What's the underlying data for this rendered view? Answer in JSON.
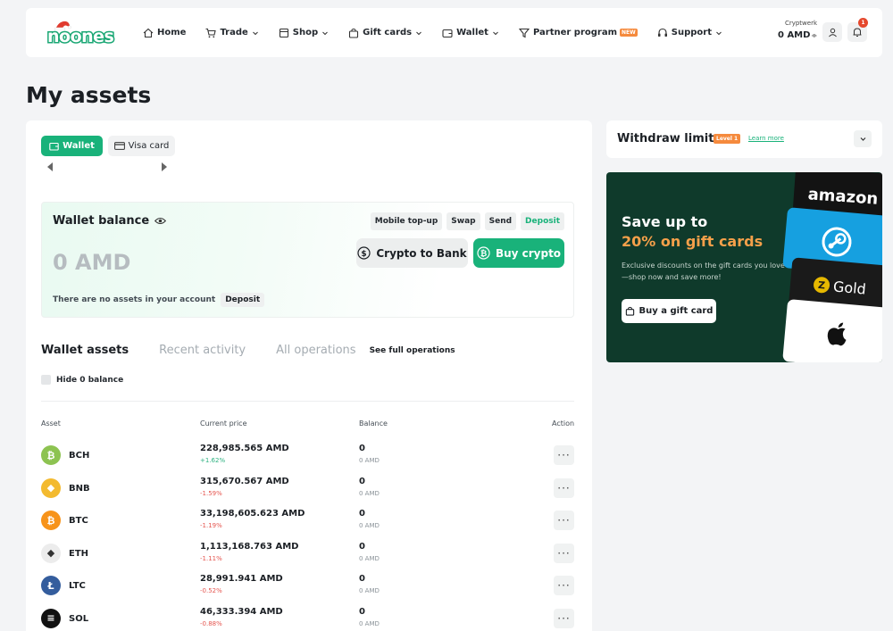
{
  "brand": {
    "logo_text": "noones",
    "accent": "#19b27a",
    "alert": "#e5482d"
  },
  "nav": {
    "items": [
      {
        "label": "Home",
        "icon": "home-icon",
        "dropdown": false
      },
      {
        "label": "Trade",
        "icon": "cart-icon",
        "dropdown": true
      },
      {
        "label": "Shop",
        "icon": "shop-icon",
        "dropdown": true
      },
      {
        "label": "Gift cards",
        "icon": "bag-icon",
        "dropdown": true
      },
      {
        "label": "Wallet",
        "icon": "wallet-icon",
        "dropdown": true
      },
      {
        "label": "Partner program",
        "icon": "partner-icon",
        "dropdown": false,
        "badge": "NEW"
      },
      {
        "label": "Support",
        "icon": "headset-icon",
        "dropdown": true
      }
    ],
    "account_name": "Cryptwerk",
    "account_balance": "0 AMD",
    "notifications": "1"
  },
  "page_title": "My assets",
  "wallet_tabs": {
    "wallet": "Wallet",
    "visa": "Visa card"
  },
  "balance": {
    "title": "Wallet balance",
    "quick_actions": [
      "Mobile top-up",
      "Swap",
      "Send",
      "Deposit"
    ],
    "amount": "0 AMD",
    "empty_text": "There are no assets in your account",
    "deposit": "Deposit",
    "crypto_to_bank": "Crypto to Bank",
    "buy_crypto": "Buy crypto"
  },
  "sub_tabs": {
    "wallet_assets": "Wallet assets",
    "recent_activity": "Recent activity",
    "all_operations": "All operations",
    "see_full": "See full operations"
  },
  "hide_zero": "Hide 0 balance",
  "table": {
    "headers": {
      "asset": "Asset",
      "price": "Current price",
      "balance": "Balance",
      "action": "Action"
    },
    "rows": [
      {
        "symbol": "BCH",
        "glyph": "₿",
        "color": "#8dc351",
        "price": "228,985.565 AMD",
        "change": "+1.62%",
        "dir": "up",
        "balance": "0",
        "balance_sub": "0 AMD"
      },
      {
        "symbol": "BNB",
        "glyph": "◆",
        "color": "#f3ba2f",
        "price": "315,670.567 AMD",
        "change": "-1.59%",
        "dir": "down",
        "balance": "0",
        "balance_sub": "0 AMD"
      },
      {
        "symbol": "BTC",
        "glyph": "₿",
        "color": "#f7931a",
        "price": "33,198,605.623 AMD",
        "change": "-1.19%",
        "dir": "down",
        "balance": "0",
        "balance_sub": "0 AMD"
      },
      {
        "symbol": "ETH",
        "glyph": "◆",
        "color": "#ececec",
        "price": "1,113,168.763 AMD",
        "change": "-1.11%",
        "dir": "down",
        "balance": "0",
        "balance_sub": "0 AMD"
      },
      {
        "symbol": "LTC",
        "glyph": "Ł",
        "color": "#345d9d",
        "price": "28,991.941 AMD",
        "change": "-0.52%",
        "dir": "down",
        "balance": "0",
        "balance_sub": "0 AMD"
      },
      {
        "symbol": "SOL",
        "glyph": "≡",
        "color": "#111111",
        "price": "46,333.394 AMD",
        "change": "-0.88%",
        "dir": "down",
        "balance": "0",
        "balance_sub": "0 AMD"
      }
    ],
    "action_label": "···"
  },
  "limits": {
    "title": "Withdraw limits",
    "level": "Level 1",
    "learn_more": "Learn more"
  },
  "promo": {
    "line1": "Save up to",
    "line2": "20% on gift cards",
    "text": "Exclusive discounts on the gift cards you love—shop now and save more!",
    "button": "Buy a gift card",
    "cards": {
      "amazon": "amazon",
      "gold": "Gold"
    },
    "accent": "#f5a04a"
  }
}
